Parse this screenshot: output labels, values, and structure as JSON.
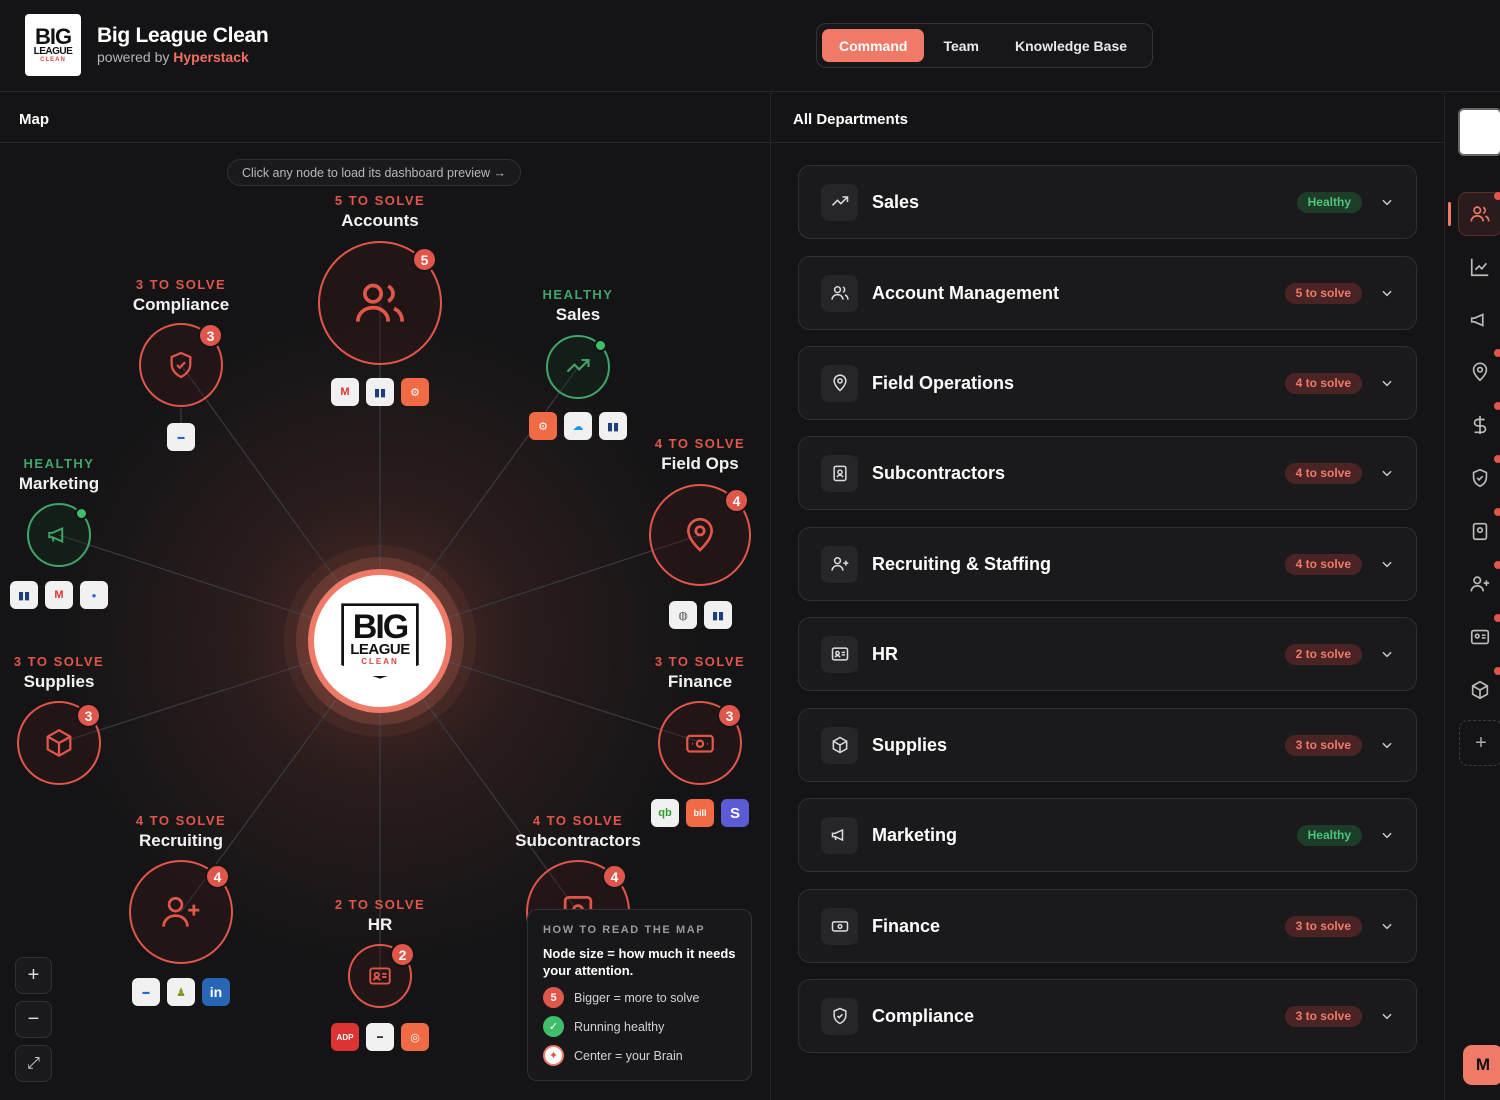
{
  "app": {
    "title": "Big League Clean",
    "powered_prefix": "powered by",
    "powered_brand": "Hyperstack",
    "logo_big": "BIG",
    "logo_league": "LEAGUE",
    "logo_clean": "CLEAN"
  },
  "nav": {
    "tabs": [
      "Command",
      "Team",
      "Knowledge Base"
    ],
    "active": "Command"
  },
  "map": {
    "title": "Map",
    "hint": "Click any node to load its dashboard preview →",
    "nodes": [
      {
        "status": "5 TO SOLVE",
        "name": "Accounts",
        "count": "5",
        "healthy": false
      },
      {
        "status": "3 TO SOLVE",
        "name": "Compliance",
        "count": "3",
        "healthy": false
      },
      {
        "status": "HEALTHY",
        "name": "Sales",
        "count": "",
        "healthy": true
      },
      {
        "status": "HEALTHY",
        "name": "Marketing",
        "count": "",
        "healthy": true
      },
      {
        "status": "4 TO SOLVE",
        "name": "Field Ops",
        "count": "4",
        "healthy": false
      },
      {
        "status": "3 TO SOLVE",
        "name": "Supplies",
        "count": "3",
        "healthy": false
      },
      {
        "status": "3 TO SOLVE",
        "name": "Finance",
        "count": "3",
        "healthy": false
      },
      {
        "status": "4 TO SOLVE",
        "name": "Recruiting",
        "count": "4",
        "healthy": false
      },
      {
        "status": "4 TO SOLVE",
        "name": "Subcontractors",
        "count": "4",
        "healthy": false
      },
      {
        "status": "2 TO SOLVE",
        "name": "HR",
        "count": "2",
        "healthy": false
      }
    ],
    "zoom": {
      "in": "+",
      "out": "−",
      "fit": "⤢"
    },
    "legend": {
      "heading": "HOW TO READ THE MAP",
      "desc": "Node size = how much it needs your attention.",
      "items": [
        {
          "badge": "5",
          "text": "Bigger = more to solve"
        },
        {
          "badge": "✓",
          "text": "Running healthy"
        },
        {
          "badge": "✦",
          "text": "Center = your Brain"
        }
      ]
    }
  },
  "departments": {
    "title": "All Departments",
    "items": [
      {
        "name": "Sales",
        "status": "Healthy",
        "healthy": true,
        "icon": "trend-icon"
      },
      {
        "name": "Account Management",
        "status": "5 to solve",
        "healthy": false,
        "icon": "users-icon"
      },
      {
        "name": "Field Operations",
        "status": "4 to solve",
        "healthy": false,
        "icon": "pin-icon"
      },
      {
        "name": "Subcontractors",
        "status": "4 to solve",
        "healthy": false,
        "icon": "badge-icon"
      },
      {
        "name": "Recruiting & Staffing",
        "status": "4 to solve",
        "healthy": false,
        "icon": "user-plus-icon"
      },
      {
        "name": "HR",
        "status": "2 to solve",
        "healthy": false,
        "icon": "id-card-icon"
      },
      {
        "name": "Supplies",
        "status": "3 to solve",
        "healthy": false,
        "icon": "box-icon"
      },
      {
        "name": "Marketing",
        "status": "Healthy",
        "healthy": true,
        "icon": "megaphone-icon"
      },
      {
        "name": "Finance",
        "status": "3 to solve",
        "healthy": false,
        "icon": "cash-icon"
      },
      {
        "name": "Compliance",
        "status": "3 to solve",
        "healthy": false,
        "icon": "shield-icon"
      }
    ]
  },
  "user": {
    "initial": "M"
  }
}
